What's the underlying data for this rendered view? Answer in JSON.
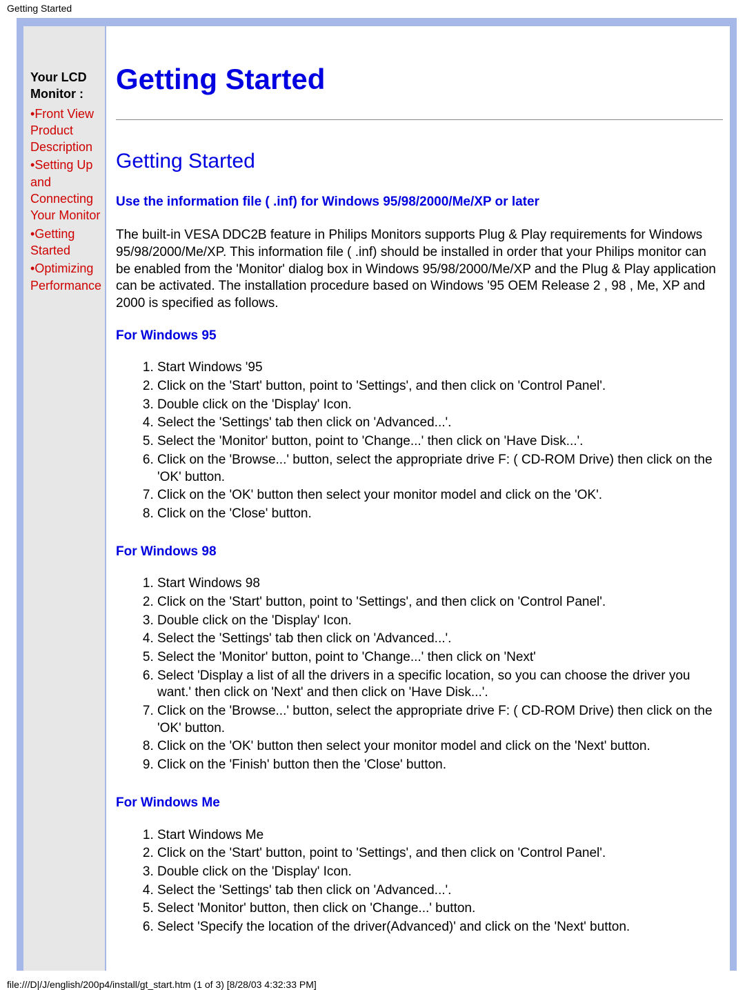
{
  "header_path": "Getting Started",
  "sidebar": {
    "title": "Your LCD Monitor :",
    "items": [
      {
        "label": "Front View Product Description"
      },
      {
        "label": "Setting Up and Connecting Your Monitor"
      },
      {
        "label": "Getting Started"
      },
      {
        "label": "Optimizing Performance"
      }
    ]
  },
  "main": {
    "title": "Getting Started",
    "subtitle": "Getting Started",
    "info_heading": "Use the information file ( .inf) for Windows 95/98/2000/Me/XP or later",
    "intro_para": "The built-in VESA DDC2B feature in Philips Monitors supports Plug & Play requirements for Windows 95/98/2000/Me/XP. This information file ( .inf) should be installed in order that your Philips monitor can be enabled from the 'Monitor' dialog box in Windows 95/98/2000/Me/XP and the Plug & Play application can be activated. The installation procedure based on Windows '95 OEM Release 2 , 98 , Me, XP and 2000 is specified as follows.",
    "sections": [
      {
        "heading": "For Windows 95",
        "steps": [
          "Start Windows '95",
          "Click on the 'Start' button, point to 'Settings', and then click on 'Control Panel'.",
          "Double click on the 'Display' Icon.",
          "Select the 'Settings' tab then click on 'Advanced...'.",
          "Select the 'Monitor' button, point to 'Change...' then click on 'Have Disk...'.",
          "Click on the 'Browse...' button, select the appropriate drive F: ( CD-ROM Drive) then click on the 'OK' button.",
          "Click on the 'OK' button then select your monitor model and click on the 'OK'.",
          "Click on the 'Close' button."
        ]
      },
      {
        "heading": "For Windows 98",
        "steps": [
          "Start Windows 98",
          "Click on the 'Start' button, point to 'Settings', and then click on 'Control Panel'.",
          "Double click on the 'Display' Icon.",
          "Select the 'Settings' tab then click on 'Advanced...'.",
          "Select the 'Monitor' button, point to 'Change...' then click on 'Next'",
          "Select 'Display a list of all the drivers in a specific location, so you can choose the driver you want.' then click on 'Next' and then click on 'Have Disk...'.",
          "Click on the 'Browse...' button, select the appropriate drive F: ( CD-ROM Drive) then click on the 'OK' button.",
          "Click on the 'OK' button then select your monitor model and click on the 'Next' button.",
          "Click on the 'Finish' button then the 'Close' button."
        ]
      },
      {
        "heading": "For Windows Me",
        "steps": [
          "Start Windows Me",
          "Click on the 'Start' button, point to 'Settings', and then click on 'Control Panel'.",
          "Double click on the 'Display' Icon.",
          "Select the 'Settings' tab then click on 'Advanced...'.",
          "Select 'Monitor' button, then click on 'Change...' button.",
          "Select 'Specify the location of the driver(Advanced)' and click on the 'Next' button."
        ]
      }
    ]
  },
  "footer_path": "file:///D|/J/english/200p4/install/gt_start.htm (1 of 3) [8/28/03 4:32:33 PM]"
}
